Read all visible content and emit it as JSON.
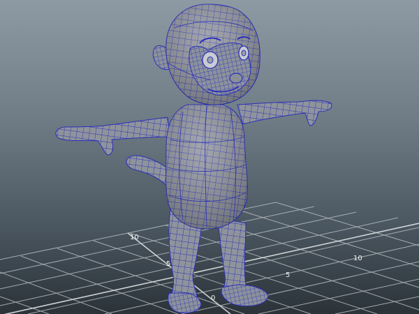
{
  "viewport": {
    "background_top": "#8e9aa3",
    "background_bottom": "#2b3339",
    "grid_color": "#b8bec2",
    "grid_major_color": "#d0d4d6",
    "mesh_fill": "#8f949c",
    "mesh_wire": "#2a2fb8"
  },
  "grid_labels": {
    "left_10": "10",
    "left_5": "5",
    "origin": "0",
    "right_5": "5",
    "right_10": "10"
  },
  "model": {
    "icon": "monkey-character-mesh"
  }
}
